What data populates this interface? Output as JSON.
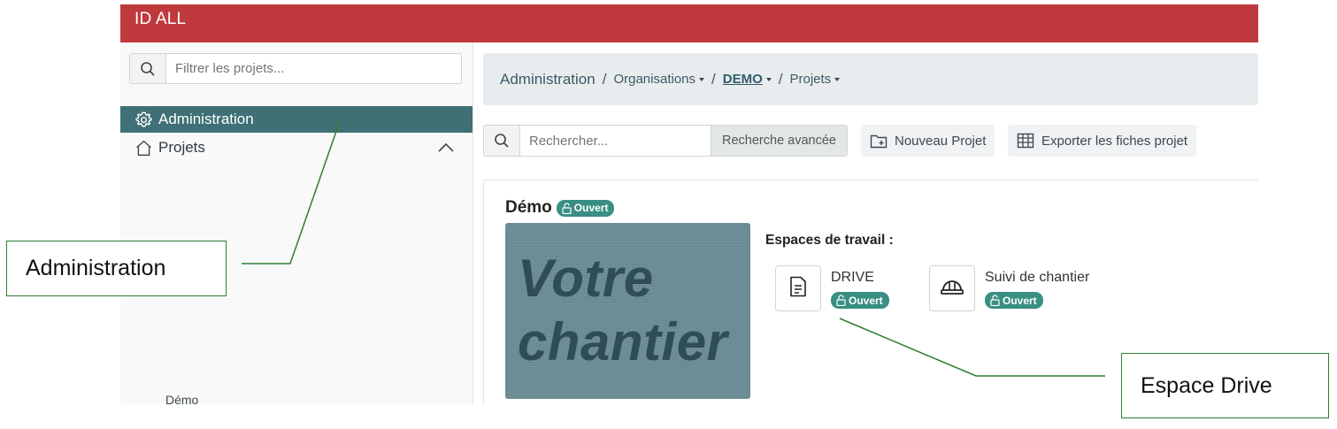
{
  "app": {
    "title": "ID ALL",
    "brand_color": "#c0393d",
    "accent_color": "#3e7076",
    "badge_color": "#3a8f83"
  },
  "sidebar": {
    "filter_placeholder": "Filtrer les projets...",
    "items": [
      {
        "label": "Administration",
        "icon": "gear-icon",
        "active": true
      },
      {
        "label": "Projets",
        "icon": "home-icon",
        "expanded": true
      }
    ],
    "sub_items": [
      "Démo"
    ]
  },
  "breadcrumb": {
    "root": "Administration",
    "items": [
      {
        "label": "Organisations"
      },
      {
        "label": "DEMO"
      },
      {
        "label": "Projets"
      }
    ]
  },
  "toolbar": {
    "search_placeholder": "Rechercher...",
    "advanced_search": "Recherche avancée",
    "new_project": "Nouveau Projet",
    "export": "Exporter les fiches projet"
  },
  "project": {
    "name": "Démo",
    "status": "Ouvert",
    "image_text_line1": "Votre",
    "image_text_line2": "chantier",
    "workspaces_title": "Espaces de travail :",
    "workspaces": [
      {
        "name": "DRIVE",
        "status": "Ouvert",
        "icon": "document-icon"
      },
      {
        "name": "Suivi de chantier",
        "status": "Ouvert",
        "icon": "helmet-icon"
      }
    ]
  },
  "annotations": [
    {
      "label": "Administration"
    },
    {
      "label": "Espace Drive"
    }
  ]
}
